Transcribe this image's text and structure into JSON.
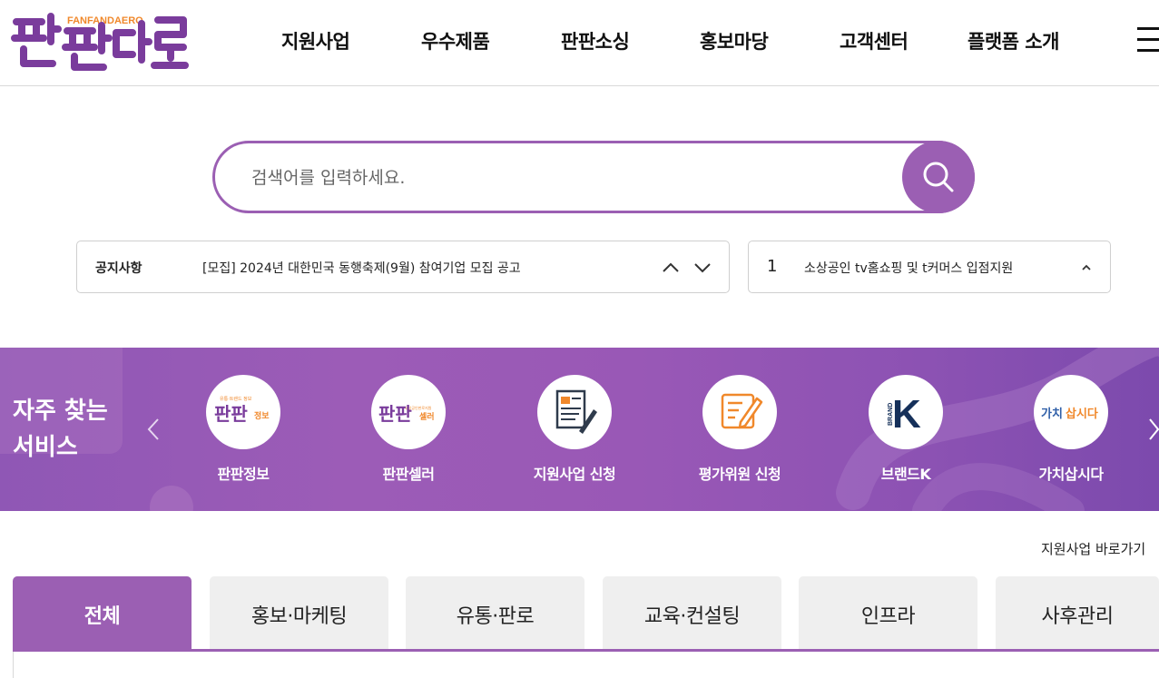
{
  "brand": {
    "logo_text": "판판대로",
    "logo_sub": "FANFANDAERO",
    "primary_color": "#9b5fb3",
    "accent_color": "#f0882b"
  },
  "nav": {
    "items": [
      {
        "label": "지원사업"
      },
      {
        "label": "우수제품"
      },
      {
        "label": "판판소싱"
      },
      {
        "label": "홍보마당"
      },
      {
        "label": "고객센터"
      },
      {
        "label": "플랫폼 소개"
      }
    ],
    "menu_icon": "hamburger-menu-icon"
  },
  "search": {
    "placeholder": "검색어를 입력하세요.",
    "value": "",
    "button_icon": "search-icon"
  },
  "notice": {
    "label": "공지사항",
    "text": "[모집] 2024년 대한민국 동행축제(9월) 참여기업 모집 공고",
    "prev_icon": "chevron-up-icon",
    "next_icon": "chevron-down-icon"
  },
  "ranking": {
    "rank": "1",
    "text": "소상공인 tv홈쇼핑 및 t커머스 입점지원",
    "toggle_icon": "chevron-up-icon"
  },
  "services": {
    "title_line1": "자주 찾는",
    "title_line2": "서비스",
    "prev_icon": "chevron-left-icon",
    "next_icon": "chevron-right-icon",
    "items": [
      {
        "label": "판판정보",
        "icon": "fanfan-info-logo-icon",
        "badge_text": "판판",
        "badge_sub": "정보",
        "badge_caption": "유통·트렌드 정보"
      },
      {
        "label": "판판셀러",
        "icon": "fanfan-seller-logo-icon",
        "badge_text": "판판",
        "badge_sub": "셀러",
        "badge_caption": "소상공인판로지원"
      },
      {
        "label": "지원사업 신청",
        "icon": "document-pen-icon"
      },
      {
        "label": "평가위원 신청",
        "icon": "form-edit-icon"
      },
      {
        "label": "브랜드K",
        "icon": "brand-k-logo-icon",
        "badge_text": "K",
        "badge_sub": "BRAND"
      },
      {
        "label": "가치삽시다",
        "icon": "gachi-logo-icon",
        "badge_text": "가치",
        "badge_sub": "삽시다"
      }
    ]
  },
  "quick_link": {
    "label": "지원사업 바로가기"
  },
  "tabs": {
    "items": [
      {
        "label": "전체",
        "active": true
      },
      {
        "label": "홍보·마케팅",
        "active": false
      },
      {
        "label": "유통·판로",
        "active": false
      },
      {
        "label": "교육·컨설팅",
        "active": false
      },
      {
        "label": "인프라",
        "active": false
      },
      {
        "label": "사후관리",
        "active": false
      }
    ]
  }
}
